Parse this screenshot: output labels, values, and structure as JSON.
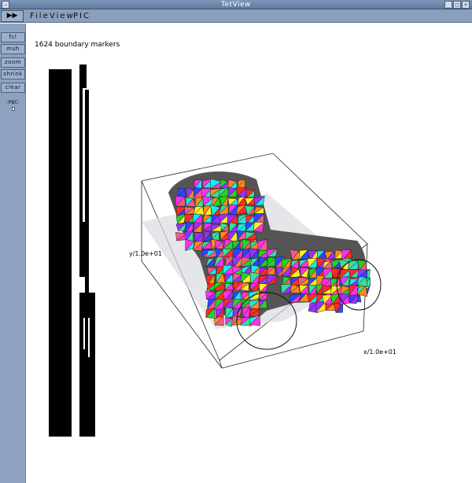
{
  "window": {
    "title": "TetView",
    "buttons": {
      "system": "–",
      "minimize": "_",
      "maximize": "□",
      "close": "×"
    }
  },
  "menubar": {
    "play_label": "▶▶",
    "items": [
      "File",
      "View",
      "PIC"
    ]
  },
  "toolbar": {
    "buttons": [
      "fcl",
      "msh",
      "zoom",
      "shrink",
      "clear"
    ],
    "select_label": "-PBC-"
  },
  "canvas": {
    "status_text": "1624 boundary markers",
    "axis_labels": {
      "x": "x/1.0e+01",
      "y": "y/1.0e+01"
    }
  },
  "colors": {
    "titlebar": "#6a86aa",
    "toolbar_bg": "#8da2bf",
    "mesh_palette": [
      "#ff2a2a",
      "#26d426",
      "#2a48ff",
      "#ffee22",
      "#22e6e6",
      "#ff30e8",
      "#ff8c1a",
      "#9b30ff",
      "#3adf9a",
      "#f05a8a"
    ]
  }
}
